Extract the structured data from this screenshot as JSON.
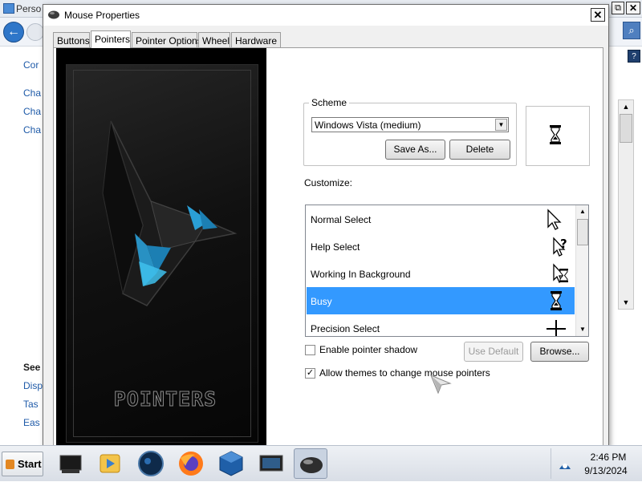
{
  "background_window": {
    "title": "Perso",
    "links": [
      "Cor",
      "Cha",
      "Cha",
      "Cha"
    ],
    "see_also_heading": "See",
    "see_also_links": [
      "Disp",
      "Tas",
      "Eas"
    ]
  },
  "dialog": {
    "title": "Mouse Properties",
    "close_glyph": "✕",
    "tabs": [
      "Buttons",
      "Pointers",
      "Pointer Options",
      "Wheel",
      "Hardware"
    ],
    "active_tab": "Pointers",
    "artwork_text": "POINTERS",
    "scheme": {
      "legend": "Scheme",
      "selected": "Windows Vista (medium)",
      "save_as_label": "Save As...",
      "delete_label": "Delete"
    },
    "customize_label": "Customize:",
    "cursor_list": [
      {
        "label": "Normal Select",
        "icon": "arrow-cursor-icon",
        "selected": false
      },
      {
        "label": "Help Select",
        "icon": "help-cursor-icon",
        "selected": false
      },
      {
        "label": "Working In Background",
        "icon": "working-cursor-icon",
        "selected": false
      },
      {
        "label": "Busy",
        "icon": "hourglass-cursor-icon",
        "selected": true
      },
      {
        "label": "Precision Select",
        "icon": "crosshair-cursor-icon",
        "selected": false
      }
    ],
    "enable_shadow": {
      "label": "Enable pointer shadow",
      "checked": false
    },
    "allow_themes": {
      "label": "Allow themes to change mouse pointers",
      "checked": true
    },
    "use_default_label": "Use Default",
    "browse_label": "Browse..."
  },
  "taskbar": {
    "start_label": "Start",
    "apps": [
      "console-app-icon",
      "media-player-icon",
      "globe-icon",
      "firefox-icon",
      "virtualbox-icon",
      "monitor-icon",
      "mouse-app-icon"
    ],
    "active_app": "mouse-app-icon",
    "clock_time": "2:46 PM",
    "clock_date": "9/13/2024"
  },
  "colors": {
    "selection": "#3399ff",
    "link": "#1e5aa8",
    "art_accent": "#2a9fd6"
  }
}
